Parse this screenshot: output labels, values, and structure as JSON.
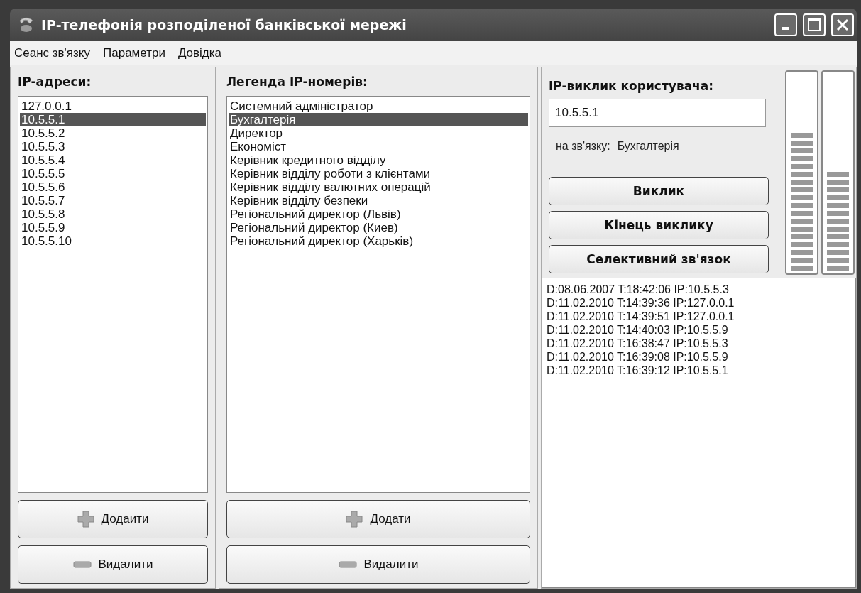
{
  "window": {
    "title": "IP-телефонія розподіленої банківської мережі"
  },
  "menu": [
    "Сеанс зв'язку",
    "Параметри",
    "Довідка"
  ],
  "ip_panel": {
    "heading": "IP-адреси:",
    "items": [
      {
        "text": "127.0.0.1",
        "selected": false
      },
      {
        "text": "10.5.5.1",
        "selected": true
      },
      {
        "text": "10.5.5.2",
        "selected": false
      },
      {
        "text": "10.5.5.3",
        "selected": false
      },
      {
        "text": "10.5.5.4",
        "selected": false
      },
      {
        "text": "10.5.5.5",
        "selected": false
      },
      {
        "text": "10.5.5.6",
        "selected": false
      },
      {
        "text": "10.5.5.7",
        "selected": false
      },
      {
        "text": "10.5.5.8",
        "selected": false
      },
      {
        "text": "10.5.5.9",
        "selected": false
      },
      {
        "text": "10.5.5.10",
        "selected": false
      }
    ],
    "buttons": [
      {
        "label": "Додаити",
        "kind": "add"
      },
      {
        "label": "Видалити",
        "kind": "remove"
      }
    ]
  },
  "legend_panel": {
    "heading": "Легенда IP-номерів:",
    "items": [
      {
        "text": "Системний адміністратор",
        "selected": false
      },
      {
        "text": "Бухгалтерія",
        "selected": true
      },
      {
        "text": "Директор",
        "selected": false
      },
      {
        "text": "Економіст",
        "selected": false
      },
      {
        "text": "Керівник кредитного відділу",
        "selected": false
      },
      {
        "text": "Керівник відділу роботи з клієнтами",
        "selected": false
      },
      {
        "text": "Керівник відділу валютних операцій",
        "selected": false
      },
      {
        "text": "Керівник відділу безпеки",
        "selected": false
      },
      {
        "text": "Регіональний директор (Львів)",
        "selected": false
      },
      {
        "text": "Регіональний директор (Киев)",
        "selected": false
      },
      {
        "text": "Регіональний директор (Харьків)",
        "selected": false
      }
    ],
    "buttons": [
      {
        "label": "Додати",
        "kind": "add"
      },
      {
        "label": "Видалити",
        "kind": "remove"
      }
    ]
  },
  "call_panel": {
    "heading": "IP-виклик користувача:",
    "ip_field": {
      "value": "10.5.5.1"
    },
    "status_label": "на зв'язку:",
    "status_value": "Бухгалтерія",
    "buttons": [
      "Виклик",
      "Кінець виклику",
      "Селективний зв'язок"
    ],
    "meters": [
      {
        "level": 0.72
      },
      {
        "level": 0.52
      }
    ],
    "log": [
      "D:08.06.2007 T:18:42:06 IP:10.5.5.3",
      "D:11.02.2010 T:14:39:36 IP:127.0.0.1",
      "D:11.02.2010 T:14:39:51 IP:127.0.0.1",
      "D:11.02.2010 T:14:40:03 IP:10.5.5.9",
      "D:11.02.2010 T:16:38:47 IP:10.5.5.3",
      "D:11.02.2010 T:16:39:08 IP:10.5.5.9",
      "D:11.02.2010 T:16:39:12 IP:10.5.5.1"
    ]
  }
}
